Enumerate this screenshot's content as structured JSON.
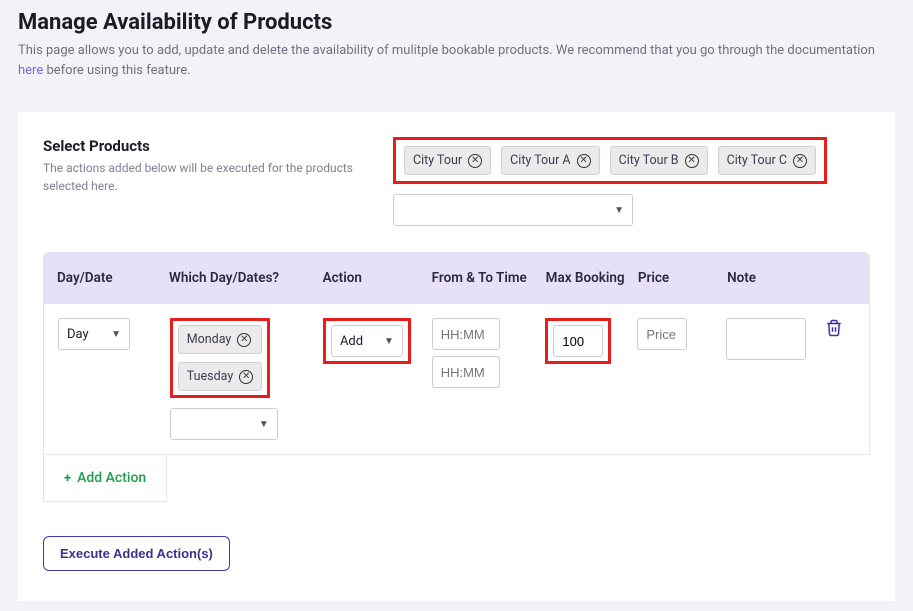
{
  "page": {
    "title": "Manage Availability of Products",
    "sub_before": "This page allows you to add, update and delete the availability of mulitple bookable products. We recommend that you go through the documentation ",
    "sub_link": "here",
    "sub_after": " before using this feature."
  },
  "select": {
    "heading": "Select Products",
    "desc": "The actions added below will be executed for the products selected here.",
    "chips": [
      "City Tour",
      "City Tour A",
      "City Tour B",
      "City Tour C"
    ],
    "dropdown_value": ""
  },
  "table": {
    "headers": {
      "daydate": "Day/Date",
      "which": "Which Day/Dates?",
      "action": "Action",
      "ft": "From & To Time",
      "max": "Max Booking",
      "price": "Price",
      "note": "Note"
    },
    "row": {
      "daydate_value": "Day",
      "which_chips": [
        "Monday",
        "Tuesday"
      ],
      "which_dropdown": "",
      "action_value": "Add",
      "from_ph": "HH:MM",
      "to_ph": "HH:MM",
      "max_value": "100",
      "price_ph": "Price",
      "note_value": ""
    }
  },
  "add_action_label": "Add Action",
  "execute_label": "Execute Added Action(s)"
}
